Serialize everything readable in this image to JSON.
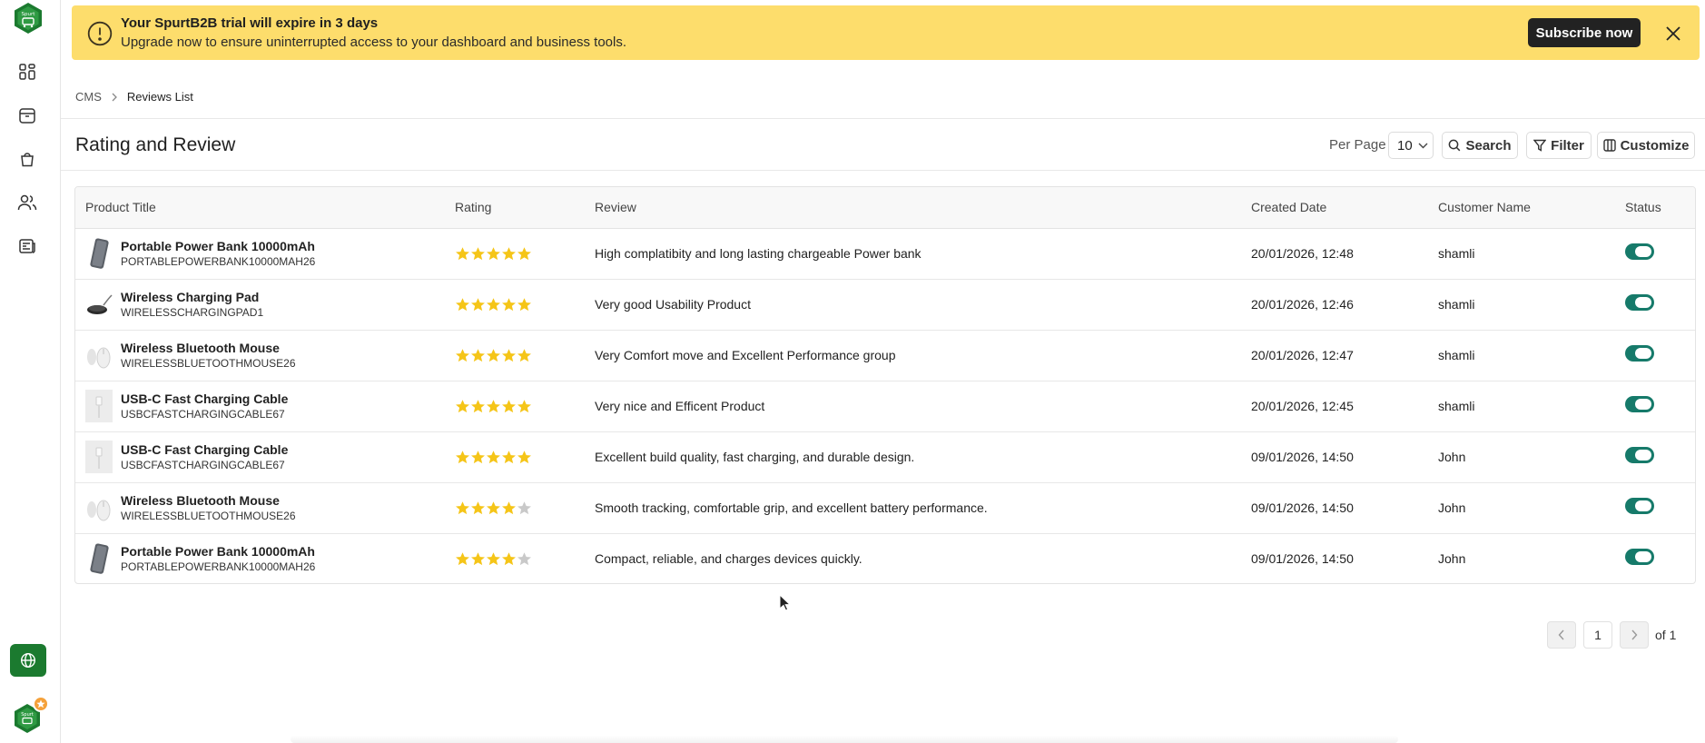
{
  "sidebar": {
    "logo_text": "Spurt",
    "items": [
      {
        "name": "dashboard-icon"
      },
      {
        "name": "catalog-icon"
      },
      {
        "name": "orders-icon"
      },
      {
        "name": "customers-icon"
      },
      {
        "name": "cms-icon"
      }
    ],
    "language_button": "globe-icon",
    "avatar_text": "Spurt",
    "brand_color": "#1b7a2f"
  },
  "banner": {
    "title": "Your SpurtB2B trial will expire in 3 days",
    "subtitle": "Upgrade now to ensure uninterrupted access to your dashboard and business tools.",
    "subscribe_label": "Subscribe now",
    "background": "#fddd6c"
  },
  "breadcrumb": {
    "parent": "CMS",
    "current": "Reviews List"
  },
  "header": {
    "title": "Rating and Review",
    "per_page_label": "Per Page",
    "per_page_value": "10",
    "search_label": "Search",
    "filter_label": "Filter",
    "customize_label": "Customize"
  },
  "table": {
    "columns": [
      "Product Title",
      "Rating",
      "Review",
      "Created Date",
      "Customer Name",
      "Status"
    ],
    "rows": [
      {
        "title": "Portable Power Bank 10000mAh",
        "sku": "PORTABLEPOWERBANK10000MAH26",
        "thumb": "power-bank",
        "rating": 5,
        "review": "High complatibity and long lasting chargeable Power bank",
        "date": "20/01/2026, 12:48",
        "customer": "shamli",
        "status": true
      },
      {
        "title": "Wireless Charging Pad",
        "sku": "WIRELESSCHARGINGPAD1",
        "thumb": "charging-pad",
        "rating": 5,
        "review": "Very good Usability Product",
        "date": "20/01/2026, 12:46",
        "customer": "shamli",
        "status": true
      },
      {
        "title": "Wireless Bluetooth Mouse",
        "sku": "WIRELESSBLUETOOTHMOUSE26",
        "thumb": "mouse",
        "rating": 5,
        "review": "Very Comfort move and Excellent Performance group",
        "date": "20/01/2026, 12:47",
        "customer": "shamli",
        "status": true
      },
      {
        "title": "USB-C Fast Charging Cable",
        "sku": "USBCFASTCHARGINGCABLE67",
        "thumb": "cable",
        "rating": 5,
        "review": "Very nice and Efficent Product",
        "date": "20/01/2026, 12:45",
        "customer": "shamli",
        "status": true
      },
      {
        "title": "USB-C Fast Charging Cable",
        "sku": "USBCFASTCHARGINGCABLE67",
        "thumb": "cable",
        "rating": 5,
        "review": "Excellent build quality, fast charging, and durable design.",
        "date": "09/01/2026, 14:50",
        "customer": "John",
        "status": true
      },
      {
        "title": "Wireless Bluetooth Mouse",
        "sku": "WIRELESSBLUETOOTHMOUSE26",
        "thumb": "mouse",
        "rating": 4,
        "review": "Smooth tracking, comfortable grip, and excellent battery performance.",
        "date": "09/01/2026, 14:50",
        "customer": "John",
        "status": true
      },
      {
        "title": "Portable Power Bank 10000mAh",
        "sku": "PORTABLEPOWERBANK10000MAH26",
        "thumb": "power-bank",
        "rating": 4,
        "review": "Compact, reliable, and charges devices quickly.",
        "date": "09/01/2026, 14:50",
        "customer": "John",
        "status": true
      }
    ]
  },
  "pagination": {
    "current_page": "1",
    "of_label": "of 1"
  },
  "colors": {
    "star_filled": "#f5c518",
    "star_empty": "#c9c9c9",
    "toggle_on": "#167a6a"
  }
}
